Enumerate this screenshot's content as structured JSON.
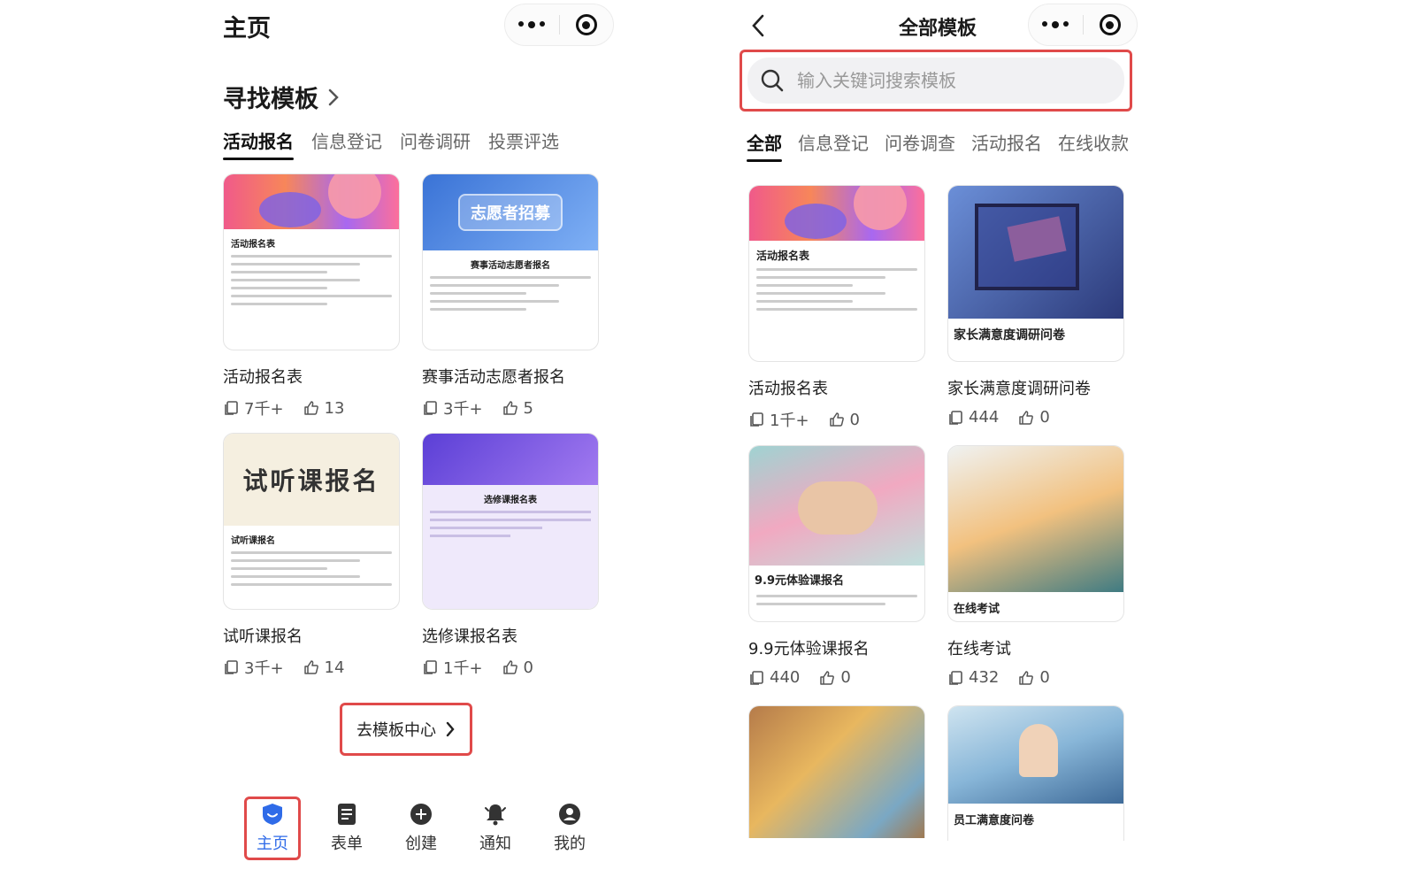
{
  "left": {
    "title": "主页",
    "section_title": "寻找模板",
    "tabs": [
      "活动报名",
      "信息登记",
      "问卷调研",
      "投票评选"
    ],
    "cards": [
      {
        "title": "活动报名表",
        "uses": "7千+",
        "likes": "13",
        "thumb_heading": "活动报名表"
      },
      {
        "title": "赛事活动志愿者报名",
        "uses": "3千+",
        "likes": "5",
        "thumb_banner": "志愿者招募",
        "thumb_heading": "赛事活动志愿者报名"
      },
      {
        "title": "试听课报名",
        "uses": "3千+",
        "likes": "14",
        "thumb_banner": "试听课报名",
        "thumb_heading": "试听课报名"
      },
      {
        "title": "选修课报名表",
        "uses": "1千+",
        "likes": "0",
        "thumb_heading": "选修课报名表"
      }
    ],
    "go_center": "去模板中心",
    "nav": [
      {
        "label": "主页"
      },
      {
        "label": "表单"
      },
      {
        "label": "创建"
      },
      {
        "label": "通知"
      },
      {
        "label": "我的"
      }
    ]
  },
  "right": {
    "title": "全部模板",
    "search_placeholder": "输入关键词搜索模板",
    "tabs": [
      "全部",
      "信息登记",
      "问卷调查",
      "活动报名",
      "在线收款"
    ],
    "cards": [
      {
        "title": "活动报名表",
        "uses": "1千+",
        "likes": "0",
        "thumb_heading": "活动报名表"
      },
      {
        "title": "家长满意度调研问卷",
        "uses": "444",
        "likes": "0",
        "thumb_heading": "家长满意度调研问卷"
      },
      {
        "title": "9.9元体验课报名",
        "uses": "440",
        "likes": "0",
        "thumb_heading": "9.9元体验课报名"
      },
      {
        "title": "在线考试",
        "uses": "432",
        "likes": "0",
        "thumb_heading": "在线考试"
      },
      {
        "title": "",
        "uses": "",
        "likes": ""
      },
      {
        "title": "",
        "uses": "",
        "likes": "",
        "thumb_heading": "员工满意度问卷"
      }
    ]
  },
  "colors": {
    "accent": "#2f6be8",
    "highlight": "#e04a4a"
  }
}
